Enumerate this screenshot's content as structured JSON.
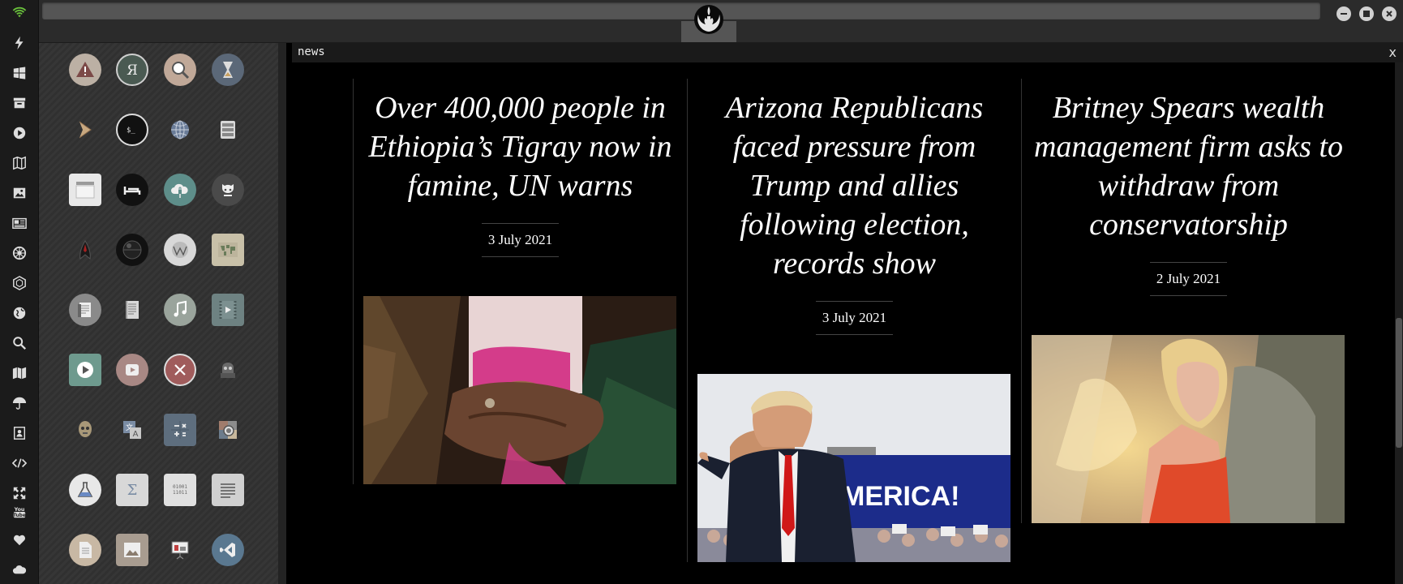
{
  "window": {
    "title": "news",
    "close_label": "x"
  },
  "articles": [
    {
      "title": "Over 400,000 people in Ethiopia’s Tigray now in famine, UN warns",
      "date": "3 July 2021"
    },
    {
      "title": "Arizona Republicans faced pressure from Trump and allies following election, records show",
      "date": "3 July 2021",
      "image_text": "MERICA!"
    },
    {
      "title": "Britney Spears wealth management firm asks to withdraw from conservatorship",
      "date": "2 July 2021"
    }
  ],
  "left_bar_icons": [
    "wifi-icon",
    "power-icon",
    "windows-icon",
    "archive-icon",
    "play-icon",
    "map-book-icon",
    "image-icon",
    "newspaper-icon",
    "empire-icon",
    "hexagon-icon",
    "globe-icon",
    "search-icon",
    "map-icon",
    "umbrella-icon",
    "contacts-icon",
    "code-icon",
    "expand-icon",
    "youtube-icon",
    "heart-icon",
    "cloud-icon"
  ],
  "launcher_apps": [
    "warning-icon",
    "yandex-icon",
    "magnifier-icon",
    "hourglass-icon",
    "terminal-arrow-icon",
    "terminal-icon",
    "globe-icon",
    "server-icon",
    "window-icon",
    "bed-icon",
    "cloud-lock-icon",
    "github-icon",
    "starfleet-icon",
    "death-star-icon",
    "wikipedia-icon",
    "world-map-icon",
    "book-icon",
    "document-icon",
    "music-icon",
    "video-icon",
    "play-button-icon",
    "video-camera-icon",
    "x-circle-icon",
    "droid-icon",
    "c3po-icon",
    "translate-icon",
    "calculator-icon",
    "camera-icon",
    "flask-icon",
    "sigma-icon",
    "binary-icon",
    "text-icon",
    "file-icon",
    "picture-icon",
    "presentation-icon",
    "vscode-icon"
  ],
  "colors": {
    "accent_green": "#6ac23c",
    "background": "#000000",
    "launcher_bg": "#353535"
  }
}
